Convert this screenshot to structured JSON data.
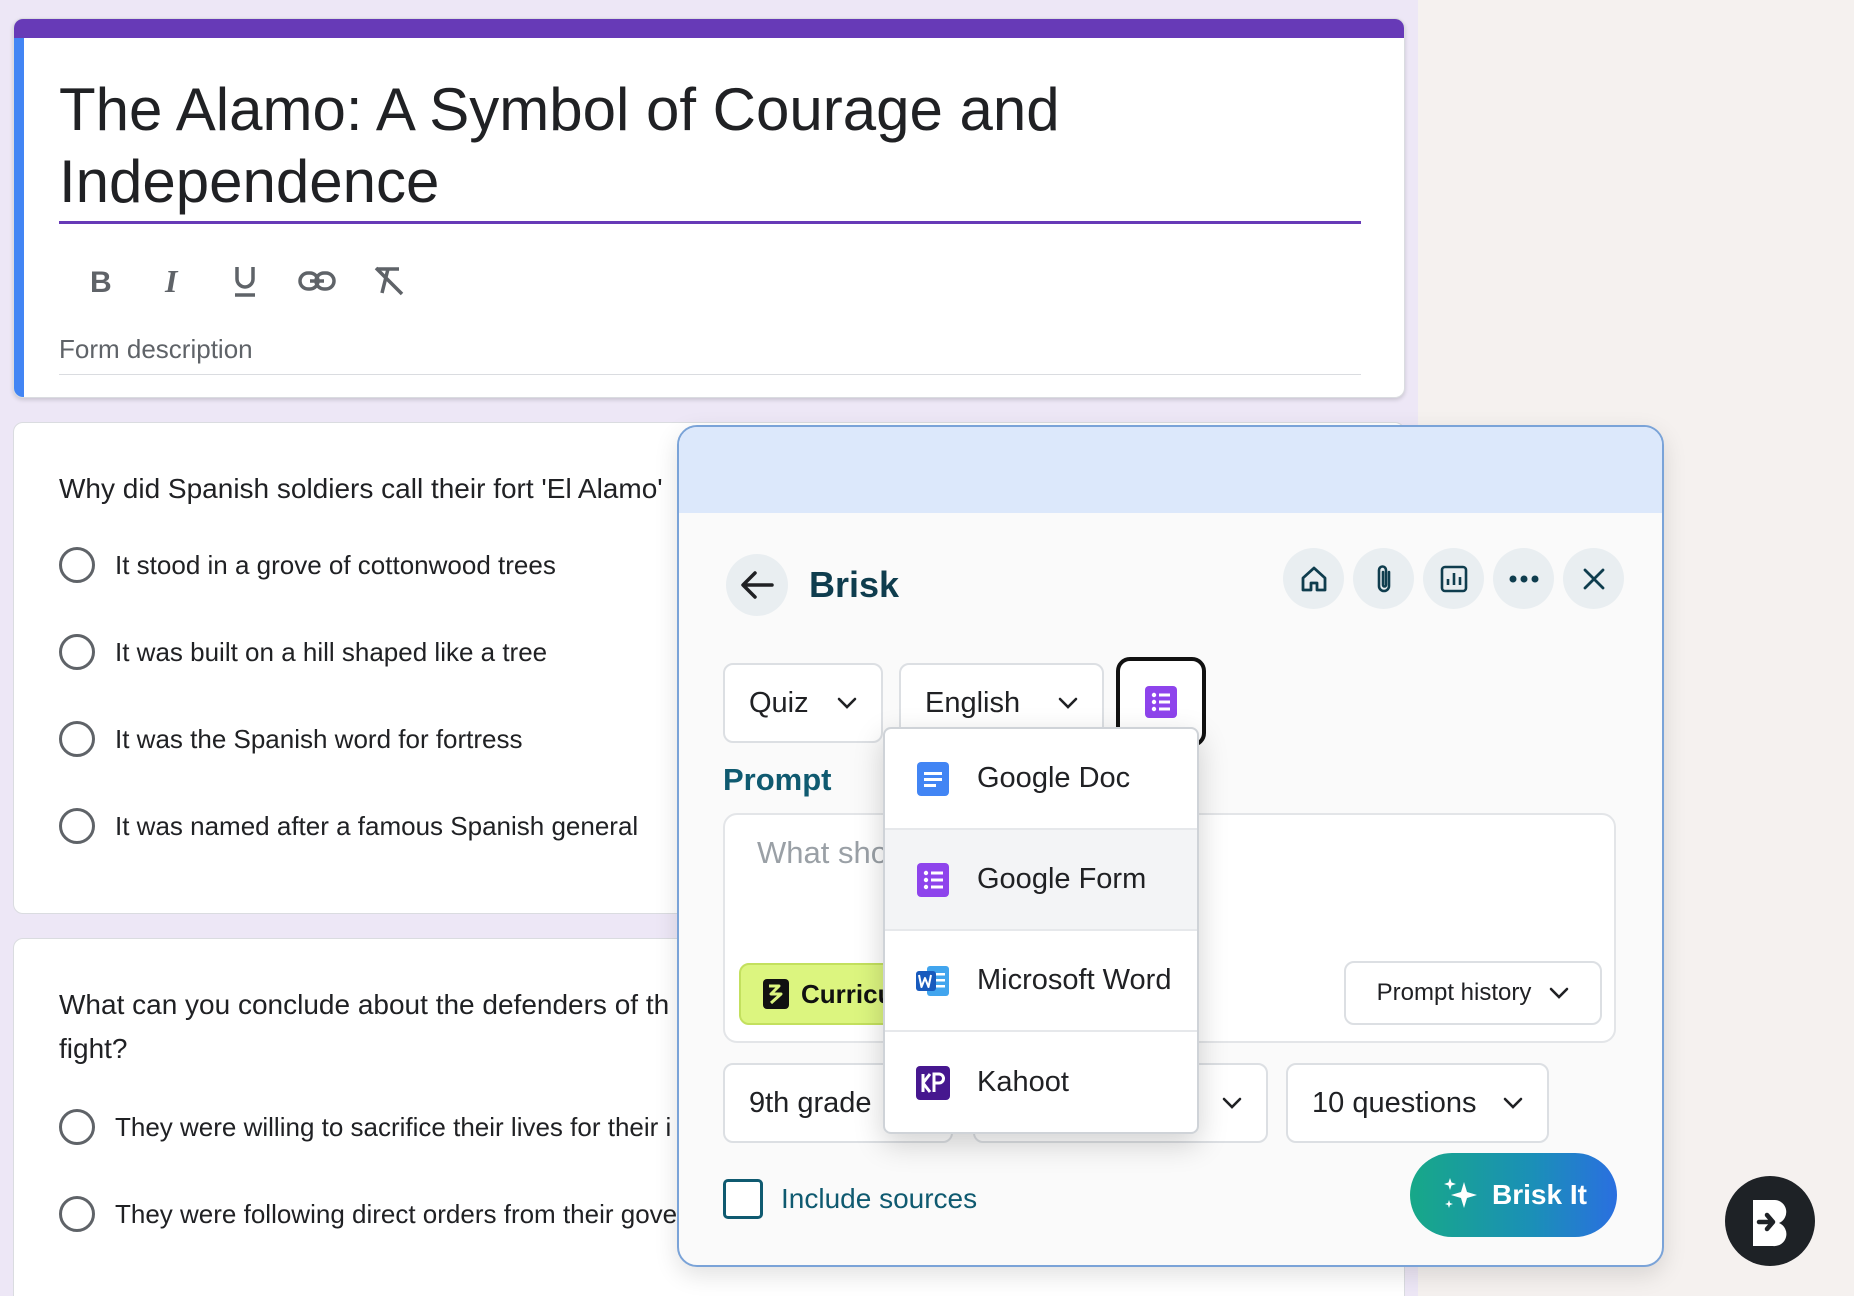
{
  "form": {
    "title": "The Alamo: A Symbol of Courage and Independence",
    "description_placeholder": "Form description",
    "questions": [
      {
        "text": "Why did Spanish soldiers call their fort 'El Alamo'",
        "options": [
          "It stood in a grove of cottonwood trees",
          "It was built on a hill shaped like a tree",
          "It was the Spanish word for fortress",
          "It was named after a famous Spanish general"
        ]
      },
      {
        "text_line1": "What can you conclude about the defenders of th",
        "text_line2": "fight?",
        "options": [
          "They were willing to sacrifice their lives for their i",
          "They were following direct orders from their gove"
        ]
      }
    ]
  },
  "brisk": {
    "title": "Brisk",
    "type_select": "Quiz",
    "language_select": "English",
    "prompt_label": "Prompt",
    "prompt_placeholder": "What sho",
    "curriculum_label": "Curricu",
    "prompt_history": "Prompt history",
    "grade_select": "9th grade",
    "questions_select": "10 questions",
    "include_sources": "Include sources",
    "brisk_it": "Brisk It",
    "export_menu": [
      {
        "label": "Google Doc",
        "icon": "google-doc-icon"
      },
      {
        "label": "Google Form",
        "icon": "google-form-icon"
      },
      {
        "label": "Microsoft Word",
        "icon": "word-icon"
      },
      {
        "label": "Kahoot",
        "icon": "kahoot-icon"
      }
    ]
  },
  "colors": {
    "forms_purple": "#673ab7",
    "forms_blue": "#4285f4",
    "brisk_teal": "#0f5a70",
    "curriculum_lime": "#dcf57f",
    "header_blue": "#dce8fb"
  }
}
